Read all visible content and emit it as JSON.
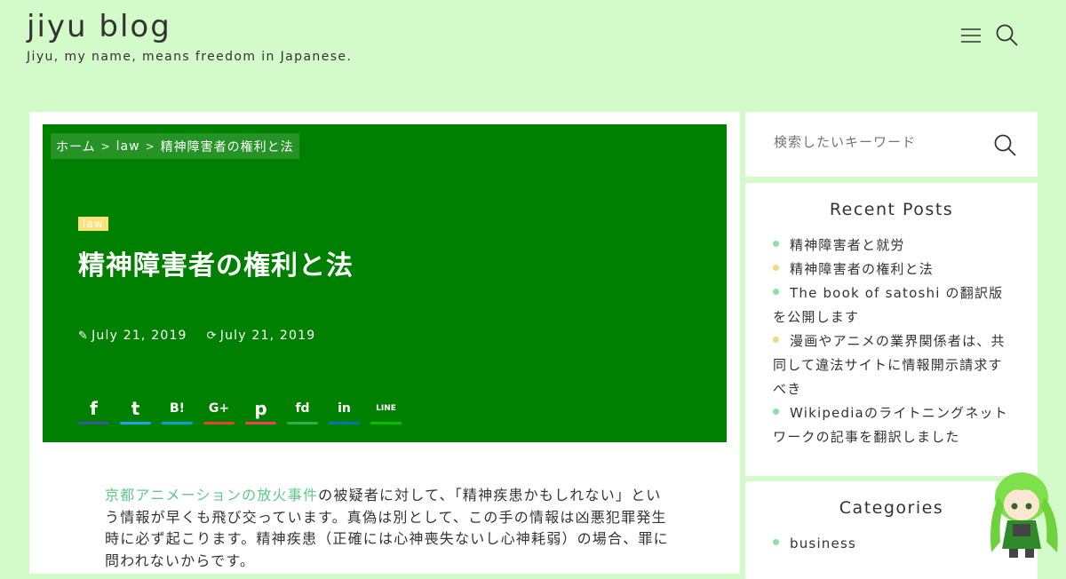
{
  "site": {
    "title": "jiyu blog",
    "description": "Jiyu, my name, means freedom in Japanese."
  },
  "breadcrumb": {
    "home": "ホーム",
    "category": "law",
    "current": "精神障害者の権利と法"
  },
  "post": {
    "category_badge": "law",
    "title": "精神障害者の権利と法",
    "published": "July 21, 2019",
    "updated": "July 21, 2019",
    "content_link": "京都アニメーションの放火事件",
    "content_text": "の被疑者に対して、「精神疾患かもしれない」という情報が早くも飛び交っています。真偽は別として、この手の情報は凶悪犯罪発生時に必ず起こります。精神疾患（正確には心神喪失ないし心神耗弱）の場合、罪に問われないからです。"
  },
  "share_buttons": [
    {
      "name": "facebook",
      "glyph": "f",
      "color": "#3b5998"
    },
    {
      "name": "twitter",
      "glyph": "t",
      "color": "#1da1f2"
    },
    {
      "name": "hatena",
      "glyph": "B!",
      "color": "#00a4de"
    },
    {
      "name": "googleplus",
      "glyph": "G+",
      "color": "#db4437"
    },
    {
      "name": "pocket",
      "glyph": "p",
      "color": "#ef3f56"
    },
    {
      "name": "feedly",
      "glyph": "fd",
      "color": "#2bb24c"
    },
    {
      "name": "linkedin",
      "glyph": "in",
      "color": "#0077b5"
    },
    {
      "name": "line",
      "glyph": "LINE",
      "color": "#00c300"
    }
  ],
  "search": {
    "placeholder": "検索したいキーワード"
  },
  "recent_posts": {
    "title": "Recent Posts",
    "items": [
      {
        "label": "精神障害者と就労",
        "dot": "#8be0a4"
      },
      {
        "label": "精神障害者の権利と法",
        "dot": "#f4d98a"
      },
      {
        "label": "The book of satoshi の翻訳版を公開します",
        "dot": "#8be0a4"
      },
      {
        "label": "漫画やアニメの業界関係者は、共同して違法サイトに情報開示請求すべき",
        "dot": "#f4d98a"
      },
      {
        "label": "Wikipediaのライトニングネットワークの記事を翻訳しました",
        "dot": "#8be0a4"
      }
    ]
  },
  "categories": {
    "title": "Categories",
    "items": [
      {
        "label": "business",
        "dot": "#8be0a4"
      }
    ]
  }
}
